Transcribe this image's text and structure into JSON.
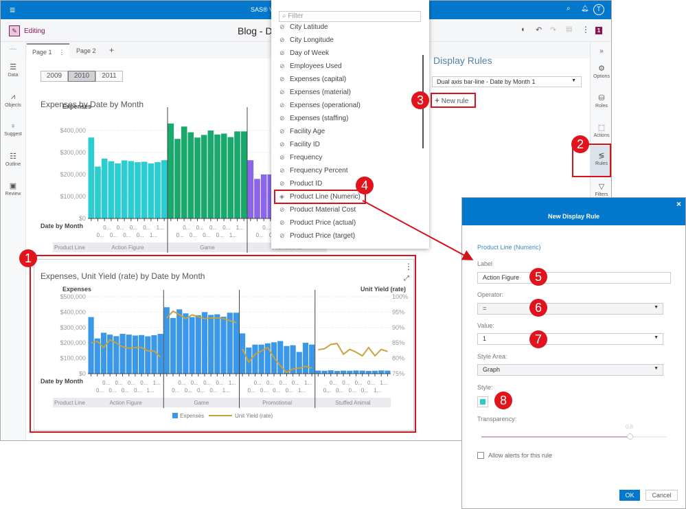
{
  "topbar": {
    "title": "SAS® Vi",
    "avatar": "T"
  },
  "toolbar": {
    "mode": "Editing",
    "report_title": "Blog - D",
    "badge": "1"
  },
  "leftrail": {
    "more": "····",
    "items": [
      {
        "label": "Data",
        "icon": "database-icon"
      },
      {
        "label": "Objects",
        "icon": "chart-icon"
      },
      {
        "label": "Suggest",
        "icon": "lightbulb-icon"
      },
      {
        "label": "Outline",
        "icon": "list-icon"
      },
      {
        "label": "Review",
        "icon": "review-icon"
      }
    ]
  },
  "tabs": [
    {
      "label": "Page 1"
    },
    {
      "label": "Page 2"
    }
  ],
  "tab_add": "+",
  "years": [
    "2009",
    "2010",
    "2011"
  ],
  "right_panel": {
    "title": "Display Rules",
    "object_select": "Dual axis bar-line - Date by Month 1",
    "new_rule": "New rule"
  },
  "rightrail": {
    "collapse": "»",
    "items": [
      {
        "label": "Options"
      },
      {
        "label": "Roles"
      },
      {
        "label": "Actions"
      },
      {
        "label": "Rules"
      },
      {
        "label": "Filters"
      }
    ]
  },
  "dropdown": {
    "placeholder": "Filter",
    "items": [
      "City Latitude",
      "City Longitude",
      "Day of Week",
      "Employees Used",
      "Expenses (capital)",
      "Expenses (material)",
      "Expenses (operational)",
      "Expenses (staffing)",
      "Facility Age",
      "Facility ID",
      "Frequency",
      "Frequency Percent",
      "Product ID",
      "Product Line (Numeric)",
      "Product Material Cost",
      "Product Price (actual)",
      "Product Price (target)"
    ]
  },
  "dialog": {
    "title": "New Display Rule",
    "close": "×",
    "column": "Product Line (Numeric)",
    "label_label": "Label",
    "label_value": "Action Figure",
    "operator_label": "Operator:",
    "operator_value": "=",
    "value_label": "Value:",
    "value_value": "1",
    "style_area_label": "Style Area:",
    "style_area_value": "Graph",
    "style_label": "Style:",
    "style_color": "#2bc9cc",
    "transparency_label": "Transparency:",
    "transparency_value": "0.8",
    "alerts_label": "Allow alerts for this rule",
    "alerts_checked": false,
    "ok": "OK",
    "cancel": "Cancel"
  },
  "callouts": [
    "1",
    "2",
    "3",
    "4",
    "5",
    "6",
    "7",
    "8"
  ],
  "chart_data": [
    {
      "type": "bar",
      "title": "Expenses by Date by Month",
      "ylabel": "Expenses",
      "xlabel": "Date by Month",
      "group_label": "Product Line",
      "yticks": [
        "$0",
        "$100,000",
        "$200,000",
        "$300,000",
        "$400,000"
      ],
      "ylim": [
        0,
        475000
      ],
      "tick_row1": [
        "0...",
        "0...",
        "0...",
        "0...",
        "1..."
      ],
      "tick_row2": [
        "0...",
        "0...",
        "0...",
        "0...",
        "1..."
      ],
      "groups": [
        {
          "name": "Action Figure",
          "color": "#2bcdd0",
          "values": [
            368000,
            236000,
            272000,
            260000,
            250000,
            264000,
            261000,
            256000,
            258000,
            250000,
            256000,
            265000
          ]
        },
        {
          "name": "Game",
          "color": "#19a96d",
          "values": [
            432000,
            362000,
            418000,
            392000,
            368000,
            380000,
            400000,
            382000,
            386000,
            370000,
            396000,
            396000
          ]
        },
        {
          "name": "Promotional",
          "color": "#8b66e8",
          "values": [
            265000,
            180000,
            200000,
            200000,
            205000,
            210000,
            218000,
            188000,
            192000,
            150000,
            208000,
            198000
          ]
        }
      ]
    },
    {
      "type": "bar-line",
      "title": "Expenses, Unit Yield (rate) by Date by Month",
      "ylabel": "Expenses",
      "y2label": "Unit Yield (rate)",
      "xlabel": "Date by Month",
      "group_label": "Product Line",
      "yticks": [
        "$0",
        "$100,000",
        "$200,000",
        "$300,000",
        "$400,000",
        "$500,000"
      ],
      "ylim": [
        0,
        500000
      ],
      "y2ticks": [
        "75%",
        "80%",
        "85%",
        "90%",
        "95%",
        "100%"
      ],
      "y2lim": [
        75,
        100
      ],
      "tick_row1": [
        "0...",
        "0...",
        "0...",
        "0...",
        "1..."
      ],
      "tick_row2": [
        "0...",
        "0...",
        "0...",
        "0...",
        "1..."
      ],
      "legend": [
        "Expenses",
        "Unit Yield (rate)"
      ],
      "bar_color": "#3b97e8",
      "line_color": "#c8a23d",
      "groups": [
        {
          "name": "Action Figure",
          "values": [
            368000,
            229000,
            266000,
            254000,
            244000,
            259000,
            254000,
            248000,
            251000,
            243000,
            250000,
            259000
          ],
          "rate": [
            85.0,
            85.5,
            83.5,
            86.0,
            85.0,
            83.7,
            83.3,
            83.5,
            83.5,
            82.4,
            82.4,
            80.3
          ]
        },
        {
          "name": "Game",
          "values": [
            432000,
            362000,
            418000,
            392000,
            368000,
            380000,
            400000,
            382000,
            386000,
            370000,
            396000,
            396000
          ],
          "rate": [
            93.1,
            95.3,
            94.2,
            92.9,
            94.1,
            93.5,
            92.9,
            93.1,
            93.1,
            92.9,
            92.2,
            91.6
          ]
        },
        {
          "name": "Promotional",
          "values": [
            262000,
            170000,
            189000,
            189000,
            197000,
            204000,
            212000,
            180000,
            185000,
            141000,
            201000,
            189000
          ],
          "rate": [
            83.1,
            78.7,
            81.3,
            82.4,
            83.5,
            80.2,
            77.6,
            75.4,
            76.5,
            76.8,
            77.4,
            76.8
          ]
        },
        {
          "name": "Stuffed Animal",
          "values": [
            20000,
            19000,
            22000,
            18000,
            20000,
            19000,
            21000,
            20000,
            18000,
            19000,
            21000,
            20000
          ],
          "rate": [
            82.8,
            83.1,
            84.5,
            84.8,
            81.3,
            82.9,
            82.0,
            80.8,
            83.5,
            80.8,
            82.9,
            82.2
          ]
        }
      ]
    }
  ]
}
